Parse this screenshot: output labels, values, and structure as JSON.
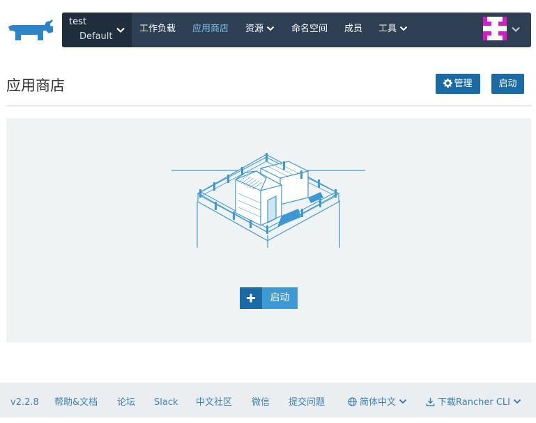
{
  "header": {
    "cluster": {
      "name": "test",
      "project": "Default"
    },
    "nav": [
      {
        "label": "工作负载"
      },
      {
        "label": "应用商店",
        "active": true
      },
      {
        "label": "资源",
        "dropdown": true
      },
      {
        "label": "命名空间"
      },
      {
        "label": "成员"
      },
      {
        "label": "工具",
        "dropdown": true
      }
    ],
    "avatar_colors": [
      "#d41bc8",
      "#ffffff"
    ]
  },
  "page": {
    "title": "应用商店",
    "manage_label": "管理",
    "launch_label": "启动"
  },
  "empty_state": {
    "launch_label": "启动"
  },
  "footer": {
    "version": "v2.2.8",
    "links": [
      "帮助&文档",
      "论坛",
      "Slack",
      "中文社区",
      "微信",
      "提交问题"
    ],
    "language": "简体中文",
    "cli": "下载Rancher CLI"
  },
  "colors": {
    "topbar": "#2f3f53",
    "cluster_bg": "#1f2d3d",
    "primary": "#1a6aa5",
    "accent": "#3d98d3",
    "active_nav": "#7fc3f5",
    "footer_link": "#3d80b5"
  }
}
